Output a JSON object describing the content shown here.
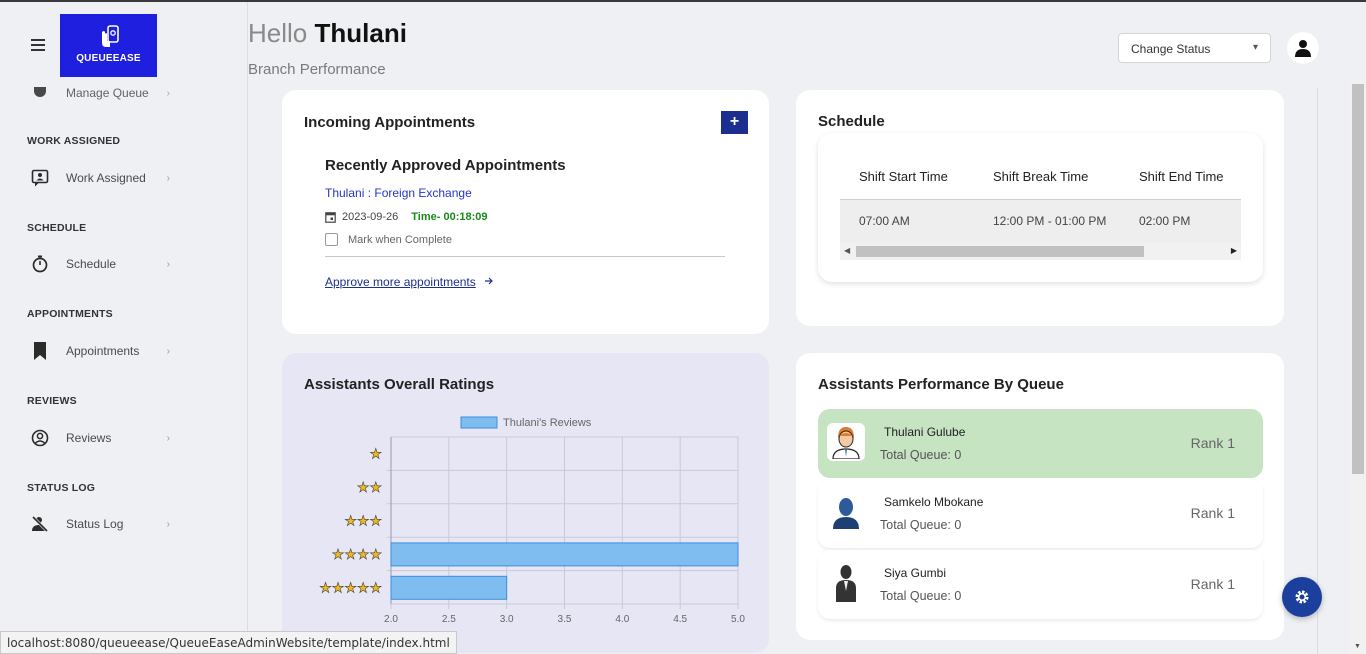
{
  "app": {
    "brand": "QUEUEEASE"
  },
  "header": {
    "greeting": "Hello",
    "user_name": "Thulani",
    "subtitle": "Branch Performance",
    "status_select": "Change Status"
  },
  "sidebar": {
    "partial_item": "Manage Queue",
    "sections": [
      {
        "title": "WORK ASSIGNED",
        "item": "Work Assigned"
      },
      {
        "title": "SCHEDULE",
        "item": "Schedule"
      },
      {
        "title": "APPOINTMENTS",
        "item": "Appointments"
      },
      {
        "title": "REVIEWS",
        "item": "Reviews"
      },
      {
        "title": "STATUS LOG",
        "item": "Status Log"
      }
    ],
    "chevron": "›"
  },
  "incoming": {
    "title": "Incoming Appointments",
    "add_label": "+",
    "recent_title": "Recently Approved Appointments",
    "link": "Thulani : Foreign Exchange",
    "date": "2023-09-26",
    "time": "Time- 00:18:09",
    "mark_label": "Mark when Complete",
    "approve_label": "Approve more appointments"
  },
  "schedule": {
    "title": "Schedule",
    "headers": [
      "Shift Start Time",
      "Shift Break Time",
      "Shift End Time"
    ],
    "row": [
      "07:00 AM",
      "12:00 PM - 01:00 PM",
      "02:00 PM"
    ]
  },
  "ratings": {
    "title": "Assistants Overall Ratings"
  },
  "chart_data": {
    "type": "bar",
    "orientation": "horizontal",
    "categories": [
      "★",
      "★★",
      "★★★",
      "★★★★",
      "★★★★★"
    ],
    "series": [
      {
        "name": "Thulani's Reviews",
        "values": [
          2,
          2,
          2,
          5,
          3
        ],
        "color": "#7fbcef"
      }
    ],
    "xlim": [
      2.0,
      5.0
    ],
    "xticks": [
      "2.0",
      "2.5",
      "3.0",
      "3.5",
      "4.0",
      "4.5",
      "5.0"
    ],
    "grid": true,
    "legend": "top"
  },
  "performance": {
    "title": "Assistants Performance By Queue",
    "items": [
      {
        "name": "Thulani Gulube",
        "queue": "Total Queue: 0",
        "rank": "Rank 1",
        "avatar": "man-worker-icon"
      },
      {
        "name": "Samkelo Mbokane",
        "queue": "Total Queue: 0",
        "rank": "Rank 1",
        "avatar": "person-blue-icon"
      },
      {
        "name": "Siya Gumbi",
        "queue": "Total Queue: 0",
        "rank": "Rank 1",
        "avatar": "person-suit-icon"
      }
    ]
  },
  "statusbar": {
    "url": "localhost:8080/queueease/QueueEaseAdminWebsite/template/index.html"
  },
  "colors": {
    "brand": "#1f1fe0",
    "accent": "#1c2f8e",
    "highlight": "#c6e3c2",
    "chart_panel": "#e7e6f5",
    "bar": "#7fbcef"
  }
}
